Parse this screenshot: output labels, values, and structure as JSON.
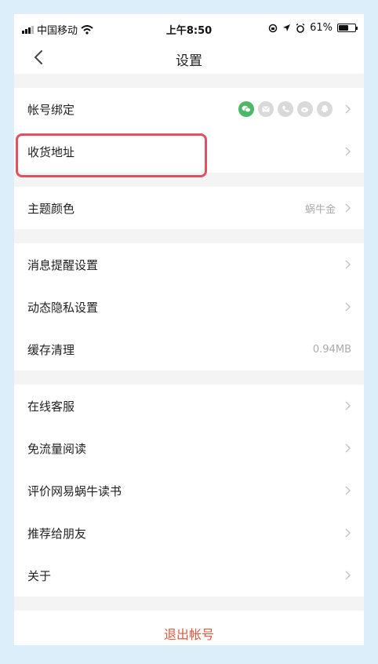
{
  "status_bar": {
    "carrier": "中国移动",
    "time": "上午8:50",
    "battery_percent": "61%",
    "battery_level": 0.61
  },
  "nav": {
    "title": "设置"
  },
  "groups": {
    "account": [
      {
        "label": "帐号绑定"
      },
      {
        "label": "收货地址"
      }
    ],
    "theme": {
      "label": "主题颜色",
      "value": "蜗牛金"
    },
    "privacy": [
      {
        "label": "消息提醒设置"
      },
      {
        "label": "动态隐私设置"
      },
      {
        "label": "缓存清理",
        "value": "0.94MB"
      }
    ],
    "about": [
      {
        "label": "在线客服"
      },
      {
        "label": "免流量阅读"
      },
      {
        "label": "评价网易蜗牛读书"
      },
      {
        "label": "推荐给朋友"
      },
      {
        "label": "关于"
      }
    ]
  },
  "logout_label": "退出帐号",
  "bind_icons": [
    "wechat-icon",
    "mail-icon",
    "phone-icon",
    "weibo-icon",
    "qq-icon"
  ],
  "colors": {
    "accent": "#e4583e",
    "highlight": "#e15260",
    "wechat": "#4cb865",
    "background": "#ddeefb"
  }
}
